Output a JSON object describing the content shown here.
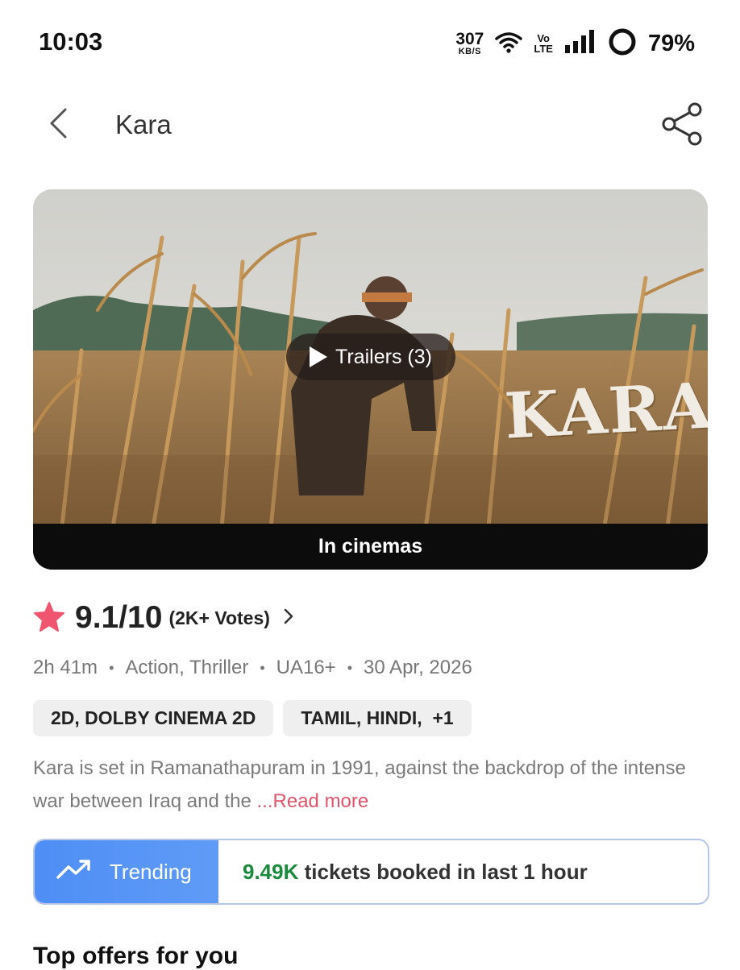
{
  "status_bar": {
    "time": "10:03",
    "net_speed": "307",
    "net_speed_unit": "KB/S",
    "volte_top": "Vo",
    "volte_bottom": "LTE",
    "battery": "79%"
  },
  "header": {
    "title": "Kara",
    "back_icon": "chevron-left-icon",
    "share_icon": "share-icon"
  },
  "banner": {
    "trailer_label": "Trailers (3)",
    "logo_text": "KARA",
    "status_label": "In cinemas"
  },
  "rating": {
    "value": "9.1/10",
    "votes": "(2K+ Votes)",
    "star_color": "#f0556f"
  },
  "meta": {
    "duration": "2h 41m",
    "genres": "Action, Thriller",
    "certificate": "UA16+",
    "release_date": "30 Apr, 2026",
    "separator": "•"
  },
  "chips": {
    "formats": "2D, DOLBY CINEMA 2D",
    "languages": "TAMIL, HINDI,  +1"
  },
  "synopsis": {
    "text": "Kara is set in Ramanathapuram in 1991, against the backdrop of the intense war between Iraq and the  ",
    "read_more": "...Read more"
  },
  "trending": {
    "label": "Trending",
    "count": "9.49K",
    "suffix": " tickets booked in last 1 hour"
  },
  "offers": {
    "title": "Top offers for you"
  }
}
